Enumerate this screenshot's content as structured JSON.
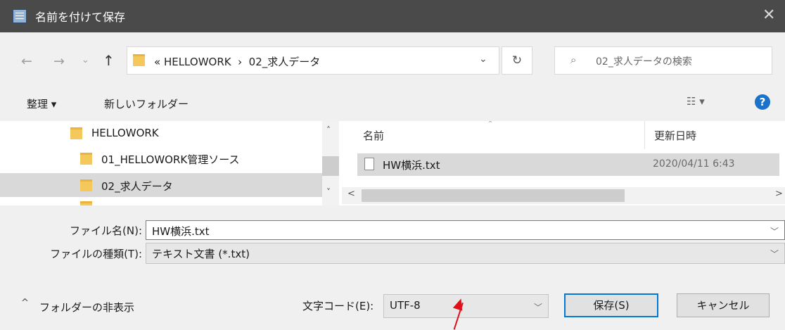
{
  "window": {
    "title": "名前を付けて保存",
    "close": "✕"
  },
  "nav": {
    "back": "←",
    "forward": "→",
    "recent": "⌄",
    "up": "↑",
    "address": "« HELLOWORK  ›  02_求人データ",
    "address_chevron": "⌄",
    "refresh": "↻",
    "search_icon": "⌕",
    "search_placeholder": "02_求人データの検索"
  },
  "toolbar": {
    "organize": "整理 ▾",
    "new_folder": "新しいフォルダー",
    "view": "☷ ▾",
    "help": "?"
  },
  "tree": {
    "items": [
      {
        "label": "HELLOWORK"
      },
      {
        "label": "01_HELLOWORK管理ソース"
      },
      {
        "label": "02_求人データ"
      }
    ],
    "scroll_up": "˄",
    "scroll_down": "˅"
  },
  "filelist": {
    "columns": {
      "name": "名前",
      "modified": "更新日時"
    },
    "sort_indicator": "˄",
    "files": [
      {
        "name": "HW横浜.txt",
        "modified": "2020/04/11 6:43"
      }
    ],
    "scroll_left": "<",
    "scroll_right": ">"
  },
  "form": {
    "filename_label": "ファイル名(N):",
    "filename_value": "HW横浜.txt",
    "filetype_label": "ファイルの種類(T):",
    "filetype_value": "テキスト文書 (*.txt)",
    "dropdown_chevron": "﹀"
  },
  "footer": {
    "hide_folders": "フォルダーの非表示",
    "hide_folders_icon": "^",
    "encoding_label": "文字コード(E):",
    "encoding_value": "UTF-8",
    "save": "保存(S)",
    "cancel": "キャンセル"
  },
  "colors": {
    "titlebar": "#4a4a4a",
    "accent": "#0078d7",
    "annotation_arrow": "#e0101a"
  }
}
